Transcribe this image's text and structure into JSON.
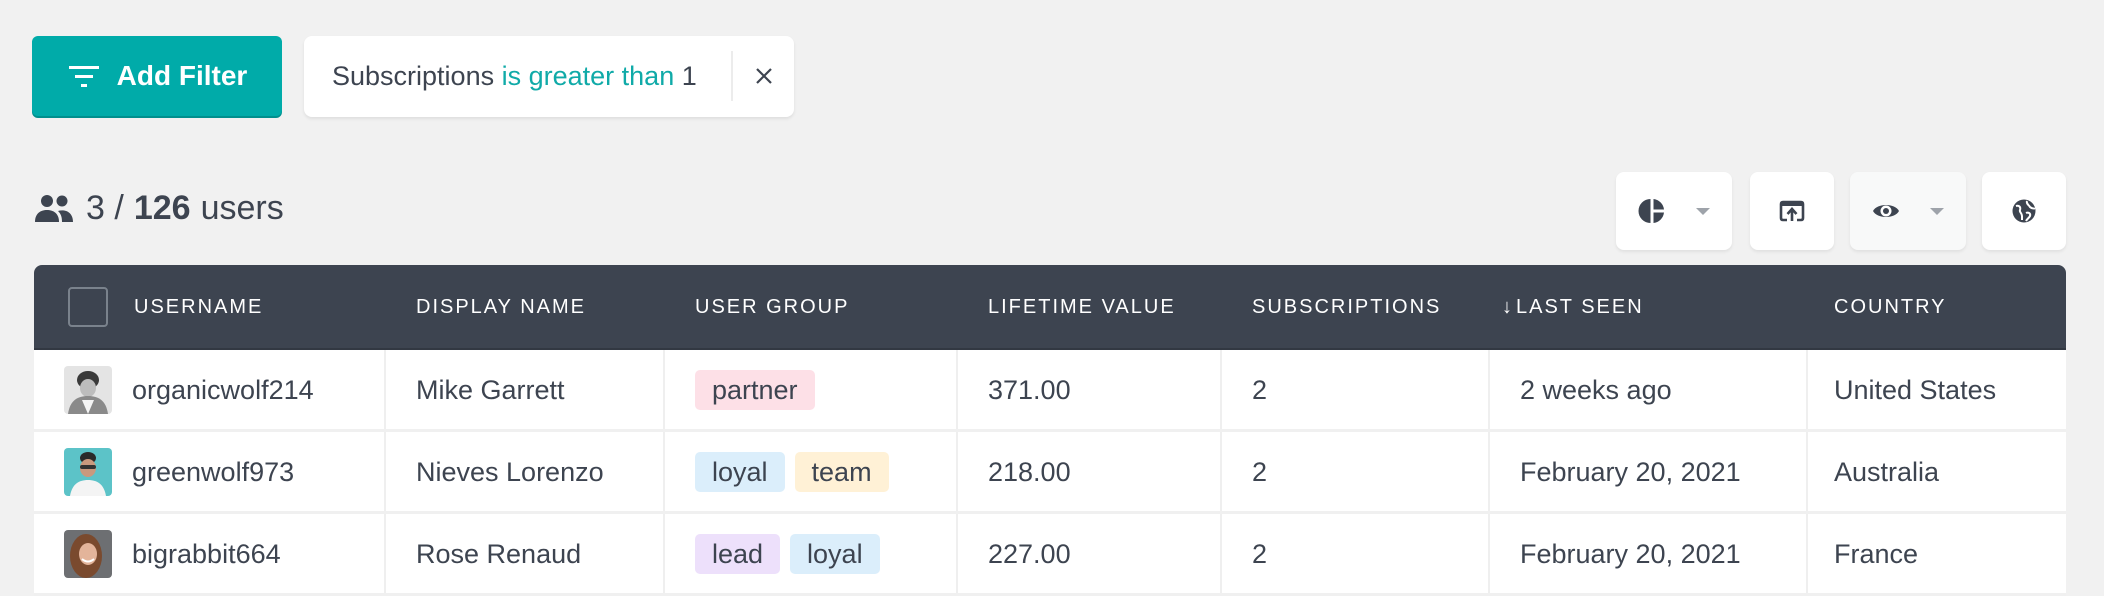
{
  "toolbar": {
    "add_filter_label": "Add Filter",
    "add_filter_icon": "filter-list-icon",
    "accent_color": "#00aba9"
  },
  "active_filter": {
    "field": "Subscriptions",
    "operator": "is greater than",
    "value": "1",
    "close_icon": "close-icon"
  },
  "summary": {
    "icon": "users-icon",
    "shown": "3",
    "separator": "/",
    "total": "126",
    "unit": "users"
  },
  "view_buttons": [
    {
      "name": "segments-button",
      "icon": "pie-chart-icon",
      "has_dropdown": true
    },
    {
      "name": "export-button",
      "icon": "export-icon",
      "has_dropdown": false
    },
    {
      "name": "columns-visibility-button",
      "icon": "eye-icon",
      "has_dropdown": true
    },
    {
      "name": "map-view-button",
      "icon": "globe-icon",
      "has_dropdown": false
    }
  ],
  "table": {
    "columns": [
      {
        "key": "username",
        "label": "USERNAME"
      },
      {
        "key": "display_name",
        "label": "DISPLAY NAME"
      },
      {
        "key": "user_group",
        "label": "USER GROUP"
      },
      {
        "key": "lifetime_value",
        "label": "LIFETIME VALUE"
      },
      {
        "key": "subscriptions",
        "label": "SUBSCRIPTIONS"
      },
      {
        "key": "last_seen",
        "label": "LAST SEEN",
        "sort": "descending",
        "sort_glyph": "↓"
      },
      {
        "key": "country",
        "label": "COUNTRY"
      }
    ],
    "tag_colors": {
      "partner": "#fde0e7",
      "loyal": "#dbeefb",
      "team": "#fff1d6",
      "lead": "#ede0fb"
    },
    "rows": [
      {
        "username": "organicwolf214",
        "avatar": "grayscale-portrait",
        "display_name": "Mike Garrett",
        "user_group": [
          "partner"
        ],
        "lifetime_value": "371.00",
        "subscriptions": "2",
        "last_seen": "2 weeks ago",
        "country": "United States"
      },
      {
        "username": "greenwolf973",
        "avatar": "teal-portrait",
        "display_name": "Nieves Lorenzo",
        "user_group": [
          "loyal",
          "team"
        ],
        "lifetime_value": "218.00",
        "subscriptions": "2",
        "last_seen": "February 20, 2021",
        "country": "Australia"
      },
      {
        "username": "bigrabbit664",
        "avatar": "curly-hair-portrait",
        "display_name": "Rose Renaud",
        "user_group": [
          "lead",
          "loyal"
        ],
        "lifetime_value": "227.00",
        "subscriptions": "2",
        "last_seen": "February 20, 2021",
        "country": "France"
      }
    ]
  }
}
